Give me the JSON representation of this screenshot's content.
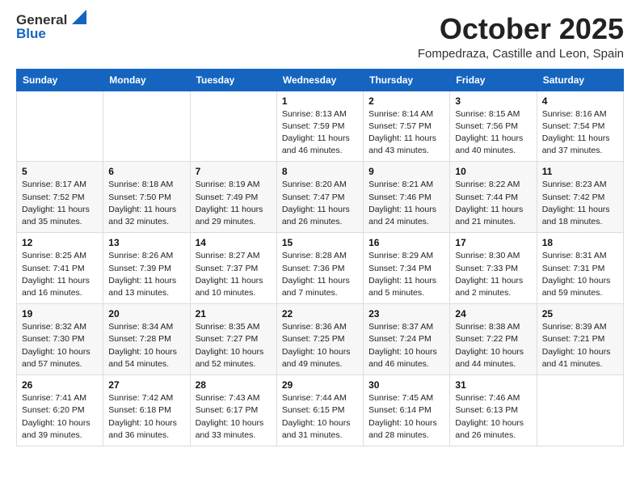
{
  "logo": {
    "general": "General",
    "blue": "Blue"
  },
  "title": "October 2025",
  "subtitle": "Fompedraza, Castille and Leon, Spain",
  "days_of_week": [
    "Sunday",
    "Monday",
    "Tuesday",
    "Wednesday",
    "Thursday",
    "Friday",
    "Saturday"
  ],
  "weeks": [
    [
      {
        "day": "",
        "info": ""
      },
      {
        "day": "",
        "info": ""
      },
      {
        "day": "",
        "info": ""
      },
      {
        "day": "1",
        "info": "Sunrise: 8:13 AM\nSunset: 7:59 PM\nDaylight: 11 hours and 46 minutes."
      },
      {
        "day": "2",
        "info": "Sunrise: 8:14 AM\nSunset: 7:57 PM\nDaylight: 11 hours and 43 minutes."
      },
      {
        "day": "3",
        "info": "Sunrise: 8:15 AM\nSunset: 7:56 PM\nDaylight: 11 hours and 40 minutes."
      },
      {
        "day": "4",
        "info": "Sunrise: 8:16 AM\nSunset: 7:54 PM\nDaylight: 11 hours and 37 minutes."
      }
    ],
    [
      {
        "day": "5",
        "info": "Sunrise: 8:17 AM\nSunset: 7:52 PM\nDaylight: 11 hours and 35 minutes."
      },
      {
        "day": "6",
        "info": "Sunrise: 8:18 AM\nSunset: 7:50 PM\nDaylight: 11 hours and 32 minutes."
      },
      {
        "day": "7",
        "info": "Sunrise: 8:19 AM\nSunset: 7:49 PM\nDaylight: 11 hours and 29 minutes."
      },
      {
        "day": "8",
        "info": "Sunrise: 8:20 AM\nSunset: 7:47 PM\nDaylight: 11 hours and 26 minutes."
      },
      {
        "day": "9",
        "info": "Sunrise: 8:21 AM\nSunset: 7:46 PM\nDaylight: 11 hours and 24 minutes."
      },
      {
        "day": "10",
        "info": "Sunrise: 8:22 AM\nSunset: 7:44 PM\nDaylight: 11 hours and 21 minutes."
      },
      {
        "day": "11",
        "info": "Sunrise: 8:23 AM\nSunset: 7:42 PM\nDaylight: 11 hours and 18 minutes."
      }
    ],
    [
      {
        "day": "12",
        "info": "Sunrise: 8:25 AM\nSunset: 7:41 PM\nDaylight: 11 hours and 16 minutes."
      },
      {
        "day": "13",
        "info": "Sunrise: 8:26 AM\nSunset: 7:39 PM\nDaylight: 11 hours and 13 minutes."
      },
      {
        "day": "14",
        "info": "Sunrise: 8:27 AM\nSunset: 7:37 PM\nDaylight: 11 hours and 10 minutes."
      },
      {
        "day": "15",
        "info": "Sunrise: 8:28 AM\nSunset: 7:36 PM\nDaylight: 11 hours and 7 minutes."
      },
      {
        "day": "16",
        "info": "Sunrise: 8:29 AM\nSunset: 7:34 PM\nDaylight: 11 hours and 5 minutes."
      },
      {
        "day": "17",
        "info": "Sunrise: 8:30 AM\nSunset: 7:33 PM\nDaylight: 11 hours and 2 minutes."
      },
      {
        "day": "18",
        "info": "Sunrise: 8:31 AM\nSunset: 7:31 PM\nDaylight: 10 hours and 59 minutes."
      }
    ],
    [
      {
        "day": "19",
        "info": "Sunrise: 8:32 AM\nSunset: 7:30 PM\nDaylight: 10 hours and 57 minutes."
      },
      {
        "day": "20",
        "info": "Sunrise: 8:34 AM\nSunset: 7:28 PM\nDaylight: 10 hours and 54 minutes."
      },
      {
        "day": "21",
        "info": "Sunrise: 8:35 AM\nSunset: 7:27 PM\nDaylight: 10 hours and 52 minutes."
      },
      {
        "day": "22",
        "info": "Sunrise: 8:36 AM\nSunset: 7:25 PM\nDaylight: 10 hours and 49 minutes."
      },
      {
        "day": "23",
        "info": "Sunrise: 8:37 AM\nSunset: 7:24 PM\nDaylight: 10 hours and 46 minutes."
      },
      {
        "day": "24",
        "info": "Sunrise: 8:38 AM\nSunset: 7:22 PM\nDaylight: 10 hours and 44 minutes."
      },
      {
        "day": "25",
        "info": "Sunrise: 8:39 AM\nSunset: 7:21 PM\nDaylight: 10 hours and 41 minutes."
      }
    ],
    [
      {
        "day": "26",
        "info": "Sunrise: 7:41 AM\nSunset: 6:20 PM\nDaylight: 10 hours and 39 minutes."
      },
      {
        "day": "27",
        "info": "Sunrise: 7:42 AM\nSunset: 6:18 PM\nDaylight: 10 hours and 36 minutes."
      },
      {
        "day": "28",
        "info": "Sunrise: 7:43 AM\nSunset: 6:17 PM\nDaylight: 10 hours and 33 minutes."
      },
      {
        "day": "29",
        "info": "Sunrise: 7:44 AM\nSunset: 6:15 PM\nDaylight: 10 hours and 31 minutes."
      },
      {
        "day": "30",
        "info": "Sunrise: 7:45 AM\nSunset: 6:14 PM\nDaylight: 10 hours and 28 minutes."
      },
      {
        "day": "31",
        "info": "Sunrise: 7:46 AM\nSunset: 6:13 PM\nDaylight: 10 hours and 26 minutes."
      },
      {
        "day": "",
        "info": ""
      }
    ]
  ]
}
